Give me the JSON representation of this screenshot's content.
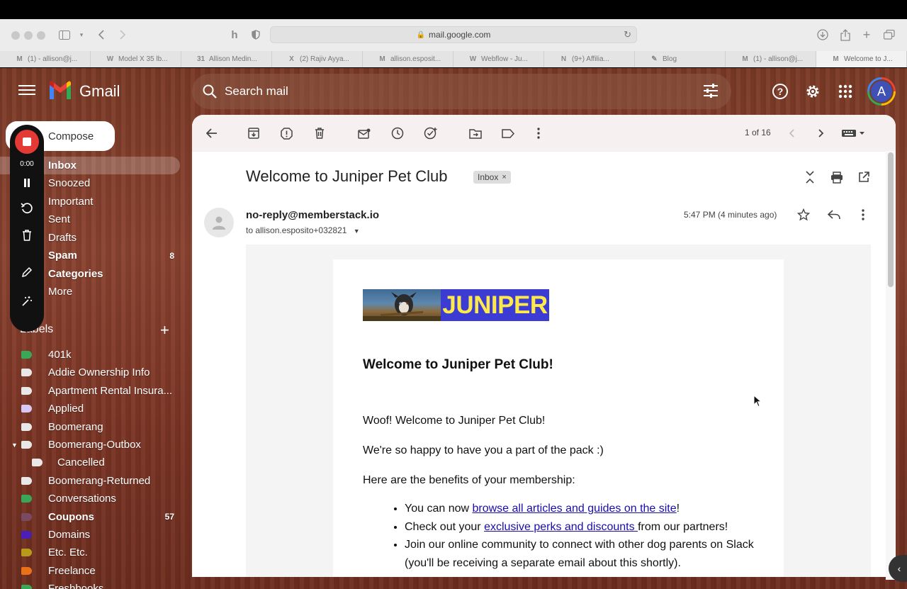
{
  "browser": {
    "url": "mail.google.com",
    "tabs": [
      {
        "fav": "M",
        "label": "(1) - allison@j..."
      },
      {
        "fav": "W",
        "label": "Model X 35 lb..."
      },
      {
        "fav": "31",
        "label": "Allison Medin..."
      },
      {
        "fav": "X",
        "label": "(2) Rajiv Ayya..."
      },
      {
        "fav": "M",
        "label": "allison.esposit..."
      },
      {
        "fav": "W",
        "label": "Webflow - Ju..."
      },
      {
        "fav": "N",
        "label": "(9+) Affilia..."
      },
      {
        "fav": "✎",
        "label": "Blog"
      },
      {
        "fav": "M",
        "label": "(1) - allison@j..."
      },
      {
        "fav": "M",
        "label": "Welcome to J..."
      }
    ]
  },
  "gmail": {
    "brand": "Gmail",
    "search_placeholder": "Search mail",
    "avatar_letter": "A",
    "compose_label": "Compose"
  },
  "recorder": {
    "time": "0:00"
  },
  "nav": [
    {
      "label": "Inbox",
      "count": ""
    },
    {
      "label": "Snoozed",
      "count": ""
    },
    {
      "label": "Important",
      "count": ""
    },
    {
      "label": "Sent",
      "count": ""
    },
    {
      "label": "Drafts",
      "count": ""
    },
    {
      "label": "Spam",
      "count": "8"
    },
    {
      "label": "Categories",
      "count": ""
    },
    {
      "label": "More",
      "count": ""
    }
  ],
  "labels_heading": "Labels",
  "labels": [
    {
      "label": "401k",
      "color": "#3aa757",
      "count": ""
    },
    {
      "label": "Addie Ownership Info",
      "color": "#e8e8e8",
      "count": ""
    },
    {
      "label": "Apartment Rental Insura...",
      "color": "#e8e8e8",
      "count": ""
    },
    {
      "label": "Applied",
      "color": "#d9c7f5",
      "count": ""
    },
    {
      "label": "Boomerang",
      "color": "#e8e8e8",
      "count": ""
    },
    {
      "label": "Boomerang-Outbox",
      "color": "#e8e8e8",
      "count": ""
    },
    {
      "label": "Cancelled",
      "color": "#e8e8e8",
      "count": ""
    },
    {
      "label": "Boomerang-Returned",
      "color": "#e8e8e8",
      "count": ""
    },
    {
      "label": "Conversations",
      "color": "#3aa757",
      "count": ""
    },
    {
      "label": "Coupons",
      "color": "#7a4a63",
      "count": "57"
    },
    {
      "label": "Domains",
      "color": "#4a1fb8",
      "count": ""
    },
    {
      "label": "Etc. Etc.",
      "color": "#b89a1a",
      "count": ""
    },
    {
      "label": "Freelance",
      "color": "#e8711a",
      "count": ""
    },
    {
      "label": "Freshbooks",
      "color": "#3aa757",
      "count": ""
    }
  ],
  "toolbar": {
    "pager": "1 of 16"
  },
  "email": {
    "subject": "Welcome to Juniper Pet Club",
    "chip": "Inbox",
    "sender": "no-reply@memberstack.io",
    "recipient": "to allison.esposito+032821",
    "time": "5:47 PM (4 minutes ago)",
    "banner_word": "JUNIPER",
    "heading": "Welcome to Juniper Pet Club!",
    "p1": "Woof! Welcome to Juniper Pet Club!",
    "p2": "We're so happy to have you a part of the pack :)",
    "p3": "Here are the benefits of your membership:",
    "b1_pre": "You can now ",
    "b1_link": "browse all articles and guides on the site",
    "b1_post": "!",
    "b2_pre": "Check out your ",
    "b2_link": "exclusive perks and discounts ",
    "b2_post": "from our partners!",
    "b3": "Join our online community to connect with other dog parents on Slack (you'll be receiving a separate email about this shortly)."
  }
}
